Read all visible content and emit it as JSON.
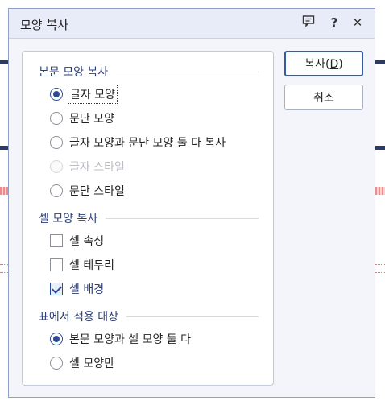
{
  "dialog": {
    "title": "모양 복사",
    "icons": [
      "comment-icon",
      "help-icon",
      "close-icon"
    ],
    "help_glyph": "?",
    "close_glyph": "✕"
  },
  "body_section": {
    "label": "본문 모양 복사",
    "options": [
      {
        "label": "글자 모양",
        "selected": true,
        "enabled": true
      },
      {
        "label": "문단 모양",
        "selected": false,
        "enabled": true
      },
      {
        "label": "글자 모양과 문단 모양 둘 다 복사",
        "selected": false,
        "enabled": true
      },
      {
        "label": "글자 스타일",
        "selected": false,
        "enabled": false
      },
      {
        "label": "문단 스타일",
        "selected": false,
        "enabled": true
      }
    ]
  },
  "cell_section": {
    "label": "셀 모양 복사",
    "options": [
      {
        "label": "셀 속성",
        "checked": false
      },
      {
        "label": "셀 테두리",
        "checked": false
      },
      {
        "label": "셀 배경",
        "checked": true
      }
    ]
  },
  "table_section": {
    "label": "표에서 적용 대상",
    "options": [
      {
        "label": "본문 모양과 셀 모양 둘 다",
        "selected": true
      },
      {
        "label": "셀 모양만",
        "selected": false
      }
    ]
  },
  "buttons": {
    "copy_label": "복사(D)",
    "copy_label_prefix": "복사(",
    "copy_label_mnemonic": "D",
    "copy_label_suffix": ")",
    "cancel_label": "취소"
  },
  "colors": {
    "accent": "#2d4a9a",
    "section_label": "#2c3e73",
    "dialog_bg": "#f3f5fb",
    "titlebar_bg": "#e8ecf8"
  }
}
